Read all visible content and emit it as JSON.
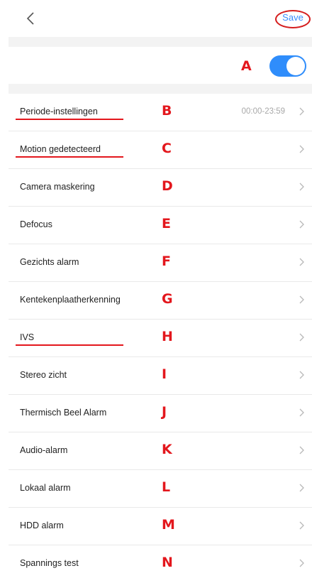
{
  "header": {
    "save_label": "Save"
  },
  "toggle": {
    "annotation": "A",
    "on": true
  },
  "colors": {
    "accent": "#2f8dfb",
    "annotation": "#e3171d",
    "save": "#3a8dff"
  },
  "rows": [
    {
      "label": "Periode-instellingen",
      "value": "00:00-23:59",
      "annotation": "B"
    },
    {
      "label": "Motion gedetecteerd",
      "value": "",
      "annotation": "C"
    },
    {
      "label": "Camera maskering",
      "value": "",
      "annotation": "D"
    },
    {
      "label": "Defocus",
      "value": "",
      "annotation": "E"
    },
    {
      "label": "Gezichts alarm",
      "value": "",
      "annotation": "F"
    },
    {
      "label": "Kentekenplaatherkenning",
      "value": "",
      "annotation": "G"
    },
    {
      "label": "IVS",
      "value": "",
      "annotation": "H"
    },
    {
      "label": "Stereo zicht",
      "value": "",
      "annotation": "I"
    },
    {
      "label": "Thermisch Beel Alarm",
      "value": "",
      "annotation": "J"
    },
    {
      "label": "Audio-alarm",
      "value": "",
      "annotation": "K"
    },
    {
      "label": "Lokaal alarm",
      "value": "",
      "annotation": "L"
    },
    {
      "label": "HDD alarm",
      "value": "",
      "annotation": "M"
    },
    {
      "label": "Spannings test",
      "value": "",
      "annotation": "N"
    }
  ]
}
